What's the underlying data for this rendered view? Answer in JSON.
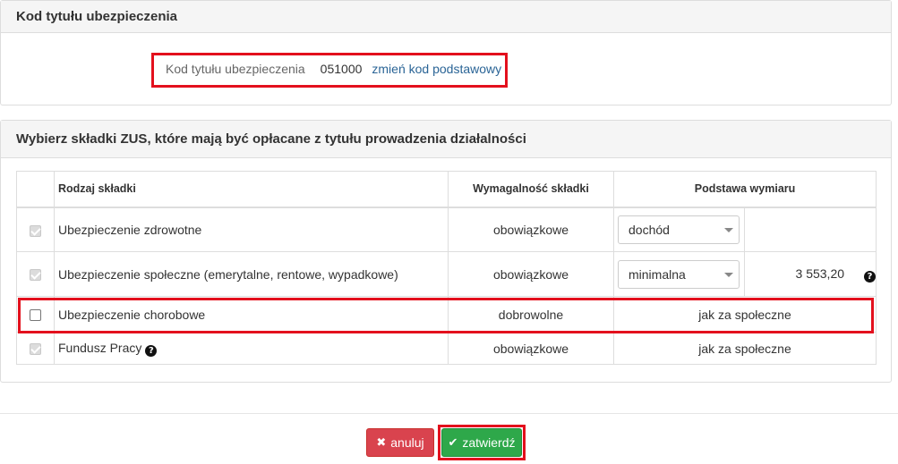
{
  "code_panel": {
    "title": "Kod tytułu ubezpieczenia",
    "label": "Kod tytułu ubezpieczenia",
    "value": "051000",
    "change_link": "zmień kod podstawowy"
  },
  "zus_panel": {
    "title": "Wybierz składki ZUS, które mają być opłacane z tytułu prowadzenia działalności",
    "headers": {
      "type": "Rodzaj składki",
      "required": "Wymagalność składki",
      "base": "Podstawa wymiaru"
    },
    "rows": [
      {
        "name": "Ubezpieczenie zdrowotne",
        "required": "obowiązkowe",
        "base_select": "dochód",
        "checked": true
      },
      {
        "name": "Ubezpieczenie społeczne (emerytalne, rentowe, wypadkowe)",
        "required": "obowiązkowe",
        "base_select": "minimalna",
        "amount": "3 553,20",
        "checked": true
      },
      {
        "name": "Ubezpieczenie chorobowe",
        "required": "dobrowolne",
        "base_text": "jak za społeczne",
        "checked": false
      },
      {
        "name": "Fundusz Pracy",
        "required": "obowiązkowe",
        "base_text": "jak za społeczne",
        "checked": true
      }
    ]
  },
  "buttons": {
    "cancel": "anuluj",
    "confirm": "zatwierdź"
  },
  "colors": {
    "highlight": "#e3101d",
    "cancel": "#d9434e",
    "confirm": "#2ea84a",
    "link": "#2a6496"
  }
}
